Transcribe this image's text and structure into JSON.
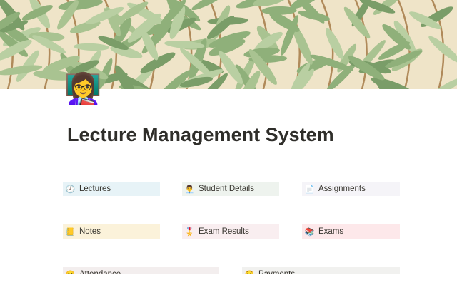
{
  "page": {
    "icon": "👩‍🏫",
    "title": "Lecture Management System"
  },
  "links": [
    {
      "label": "Lectures",
      "icon": "🕘",
      "color": "#e7f3f7"
    },
    {
      "label": "Student Details",
      "icon": "👨‍💼",
      "color": "#eef3ee"
    },
    {
      "label": "Assignments",
      "icon": "📄",
      "color": "#f5f4f8"
    },
    {
      "label": "Notes",
      "icon": "📒",
      "color": "#fbf2da"
    },
    {
      "label": "Exam Results",
      "icon": "🎖️",
      "color": "#f9eef0"
    },
    {
      "label": "Exams",
      "icon": "📚",
      "color": "#fde8ea"
    },
    {
      "label": "Attendance",
      "icon": "😊",
      "color": "#f3eeee"
    },
    {
      "label": "Payments",
      "icon": "🤑",
      "color": "#f1f1ef"
    }
  ]
}
